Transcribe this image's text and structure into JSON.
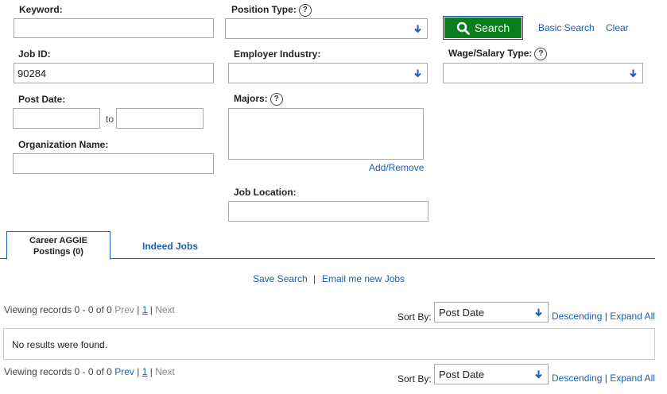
{
  "form": {
    "keyword_label": "Keyword:",
    "keyword_value": "",
    "position_type_label": "Position Type:",
    "help_glyph": "?",
    "search_button": "Search",
    "basic_search": "Basic Search",
    "clear": "Clear",
    "job_id_label": "Job ID:",
    "job_id_value": "90284",
    "employer_industry_label": "Employer Industry:",
    "wage_label": "Wage/Salary Type:",
    "post_date_label": "Post Date:",
    "to_label": "to",
    "majors_label": "Majors:",
    "add_remove": "Add/Remove",
    "org_name_label": "Organization Name:",
    "job_location_label": "Job Location:"
  },
  "tabs": [
    {
      "label_line1": "Career AGGIE",
      "label_line2": "Postings (0)",
      "active": true
    },
    {
      "label": "Indeed Jobs",
      "active": false
    }
  ],
  "actions": {
    "save_search": "Save Search",
    "separator": "|",
    "email_jobs": "Email me new Jobs"
  },
  "results": {
    "viewing_text": "Viewing records 0 - 0 of 0",
    "prev": "Prev",
    "page": "1",
    "next": "Next",
    "pipe": "|",
    "sort_by_label": "Sort By:",
    "sort_value": "Post Date",
    "descending": "Descending",
    "expand_all": "Expand All",
    "no_results": "No results were found."
  },
  "colors": {
    "search_button_bg": "#0a7d1e",
    "link": "#1a5fb4",
    "arrow": "#1a5fb4"
  }
}
